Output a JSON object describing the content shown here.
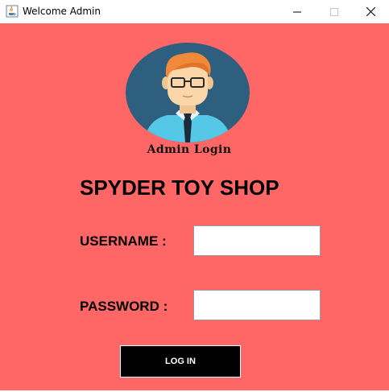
{
  "window": {
    "title": "Welcome Admin",
    "icon": "java-cup-icon",
    "controls": [
      "minimize-icon",
      "maximize-icon",
      "close-icon"
    ]
  },
  "login": {
    "avatar_icon": "admin-avatar-icon",
    "avatar_caption": "Admin Login",
    "shop_title": "SPYDER TOY SHOP",
    "username_label": "USERNAME :",
    "username_value": "",
    "password_label": "PASSWORD :",
    "password_value": "",
    "login_button": "LOG IN"
  },
  "colors": {
    "background": "#ff6666",
    "button": "#000000",
    "button_text": "#ffffff",
    "avatar_circle": "#2e5f7e",
    "shirt": "#55c8e8",
    "hair": "#f08a3a",
    "skin": "#fbd6a8"
  }
}
